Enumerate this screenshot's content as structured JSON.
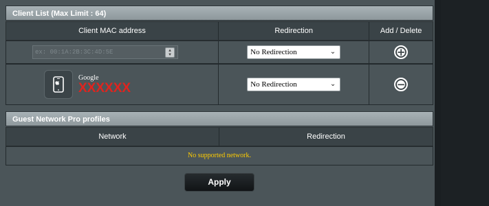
{
  "client_list": {
    "title": "Client List (Max Limit : 64)",
    "headers": [
      "Client MAC address",
      "Redirection",
      "Add / Delete"
    ],
    "new_entry": {
      "mac_placeholder": "ex: 00:1A:2B:3C:4D:5E",
      "redirection": "No Redirection",
      "action_icon": "add-circle-icon",
      "action_symbol": "+"
    },
    "clients": [
      {
        "device_icon": "phone-icon",
        "vendor": "Google",
        "name": "XXXXXX",
        "redirection": "No Redirection",
        "action_icon": "remove-circle-icon",
        "action_symbol": "−"
      }
    ]
  },
  "guest_profiles": {
    "title": "Guest Network Pro profiles",
    "headers": [
      "Network",
      "Redirection"
    ],
    "empty_message": "No supported network."
  },
  "apply_label": "Apply",
  "colors": {
    "panel": "#4b5559",
    "header_bar": "#a8b2b6",
    "device_name": "#e0241e",
    "empty_message": "#ffcc00"
  }
}
